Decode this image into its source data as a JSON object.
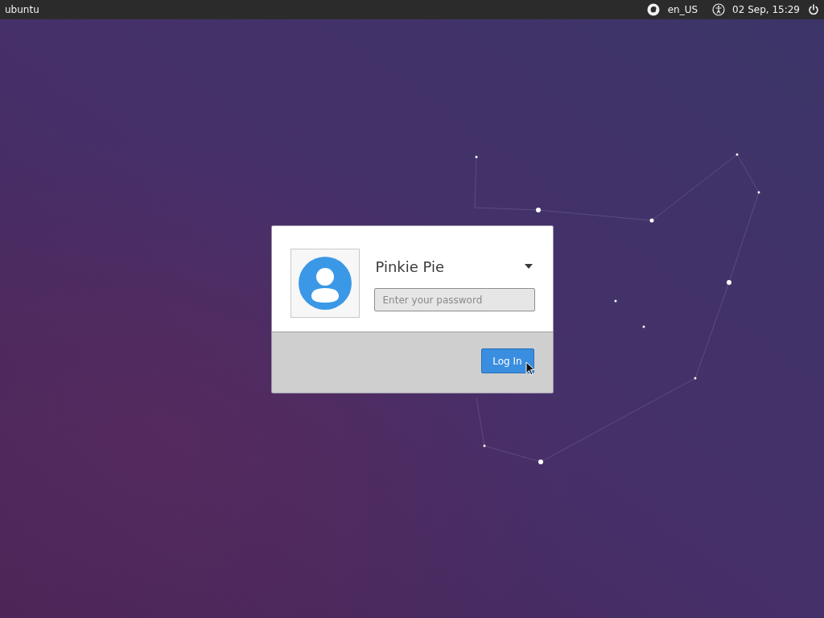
{
  "top_bar": {
    "host": "ubuntu",
    "keyboard_layout": "en_US",
    "clock": "02 Sep, 15:29"
  },
  "login": {
    "user_name": "Pinkie Pie",
    "password": {
      "placeholder": "Enter your password"
    },
    "login_button": "Log In"
  }
}
